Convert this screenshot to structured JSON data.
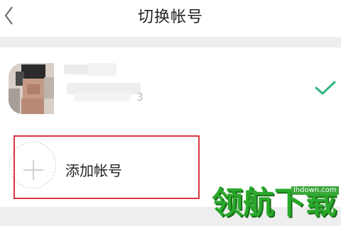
{
  "header": {
    "title": "切换帐号",
    "back_icon": "back-chevron-icon"
  },
  "accounts": [
    {
      "name_tail": "3",
      "selected": true,
      "check_icon": "checkmark-icon"
    }
  ],
  "add_account": {
    "label": "添加帐号",
    "icon": "plus-icon"
  },
  "watermark": {
    "text": "领航下载",
    "url": "lhdown.com"
  },
  "colors": {
    "check": "#2db77e",
    "highlight_border": "#d9363e",
    "divider_bg": "#eeeeee",
    "watermark": "#2aa92a"
  }
}
